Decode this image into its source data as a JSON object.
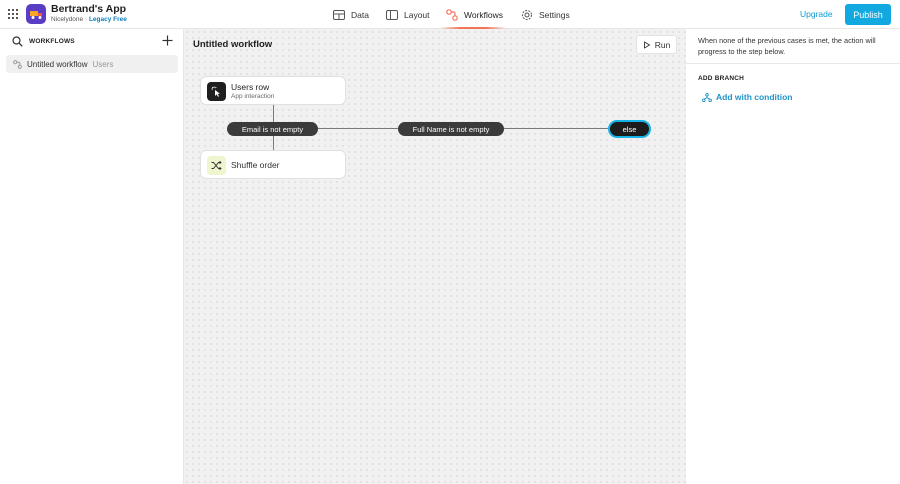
{
  "app": {
    "name": "Bertrand's App",
    "owner": "Nicelydone",
    "separator": " · ",
    "plan": "Legacy Free"
  },
  "nav": {
    "tabs": [
      {
        "label": "Data",
        "icon": "data-icon"
      },
      {
        "label": "Layout",
        "icon": "layout-icon"
      },
      {
        "label": "Workflows",
        "icon": "workflows-icon",
        "active": true
      },
      {
        "label": "Settings",
        "icon": "settings-icon"
      }
    ],
    "upgrade": "Upgrade",
    "publish": "Publish"
  },
  "sidebar": {
    "title": "WORKFLOWS",
    "items": [
      {
        "name": "Untitled workflow",
        "tag": "Users"
      }
    ]
  },
  "canvas": {
    "title": "Untitled workflow",
    "run": "Run",
    "trigger": {
      "title": "Users row",
      "subtitle": "App interaction"
    },
    "conditions": [
      "Email is not empty",
      "Full Name is not empty"
    ],
    "else": "else",
    "action": {
      "title": "Shuffle order"
    }
  },
  "panel": {
    "description": "When none of the previous cases is met, the action will progress to the step below.",
    "section_title": "ADD BRANCH",
    "add_condition": "Add with condition"
  },
  "colors": {
    "accent": "#11a9e0",
    "workflow_active": "#f37559",
    "logo": "#5b3cc4",
    "link": "#1f93c9"
  }
}
